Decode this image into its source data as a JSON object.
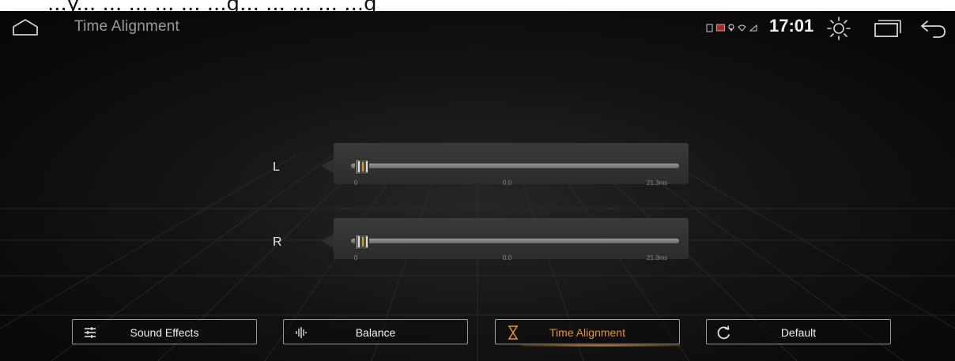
{
  "caption": "...y... ... ... ... ... ...g... ... ... ... ...g",
  "statusbar": {
    "title": "Time Alignment",
    "clock": "17:01",
    "icons": [
      "sd-card-icon",
      "notification-icon",
      "location-icon",
      "wifi-icon",
      "signal-icon"
    ]
  },
  "channels": [
    {
      "label": "L",
      "min": "0",
      "value": "0.0",
      "max": "21.3ms",
      "level": 0
    },
    {
      "label": "R",
      "min": "0",
      "value": "0.0",
      "max": "21.3ms",
      "level": 0
    }
  ],
  "tabs": [
    {
      "label": "Sound Effects",
      "icon": "equalizer-icon",
      "active": false
    },
    {
      "label": "Balance",
      "icon": "waveform-icon",
      "active": false
    },
    {
      "label": "Time Alignment",
      "icon": "hourglass-icon",
      "active": true
    },
    {
      "label": "Default",
      "icon": "reset-icon",
      "active": false
    }
  ],
  "colors": {
    "accent": "#e8951a",
    "panel": "#333333",
    "background": "#141414"
  }
}
